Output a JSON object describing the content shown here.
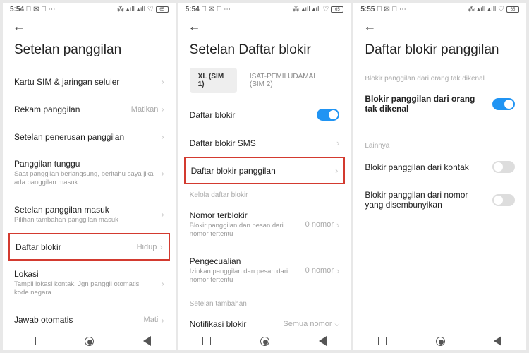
{
  "screen1": {
    "time": "5:54",
    "status_icons": "⃠ ✉ ⛶ ⋯",
    "status_right": "⁂ ▴ıll ▴ıll ♡",
    "battery": "65",
    "title": "Setelan panggilan",
    "rows": [
      {
        "label": "Kartu SIM & jaringan seluler",
        "value": "",
        "sub": ""
      },
      {
        "label": "Rekam panggilan",
        "value": "Matikan",
        "sub": ""
      },
      {
        "label": "Setelan penerusan panggilan",
        "value": "",
        "sub": ""
      },
      {
        "label": "Panggilan tunggu",
        "value": "",
        "sub": "Saat panggilan berlangsung, beritahu saya jika ada panggilan masuk"
      },
      {
        "label": "Setelan panggilan masuk",
        "value": "",
        "sub": "Pilihan tambahan panggilan masuk"
      },
      {
        "label": "Daftar blokir",
        "value": "Hidup",
        "sub": ""
      },
      {
        "label": "Lokasi",
        "value": "",
        "sub": "Tampil lokasi kontak, Jgn panggil otomatis kode negara"
      },
      {
        "label": "Jawab otomatis",
        "value": "Mati",
        "sub": ""
      }
    ]
  },
  "screen2": {
    "time": "5:54",
    "battery": "65",
    "title": "Setelan Daftar blokir",
    "tabs": [
      {
        "label": "XL (SIM 1)",
        "active": true
      },
      {
        "label": "ISAT-PEMILUDAMAI (SIM 2)",
        "active": false
      }
    ],
    "rows_top": [
      {
        "label": "Daftar blokir",
        "type": "toggle",
        "on": true
      },
      {
        "label": "Daftar blokir SMS",
        "type": "chev"
      },
      {
        "label": "Daftar blokir panggilan",
        "type": "chev",
        "highlight": true
      }
    ],
    "section1": "Kelola daftar blokir",
    "rows_mid": [
      {
        "label": "Nomor terblokir",
        "sub": "Blokir panggilan dan pesan dari nomor tertentu",
        "value": "0 nomor"
      },
      {
        "label": "Pengecualian",
        "sub": "Izinkan panggilan dan pesan dari nomor tertentu",
        "value": "0 nomor"
      }
    ],
    "section2": "Setelan tambahan",
    "rows_bot": [
      {
        "label": "Notifikasi blokir",
        "value": "Semua nomor"
      }
    ]
  },
  "screen3": {
    "time": "5:55",
    "battery": "65",
    "title": "Daftar blokir panggilan",
    "section_top": "Blokir panggilan dari orang tak dikenal",
    "rows_top": [
      {
        "label": "Blokir panggilan dari orang tak dikenal",
        "on": true
      }
    ],
    "section_bot": "Lainnya",
    "rows_bot": [
      {
        "label": "Blokir panggilan dari kontak",
        "on": false
      },
      {
        "label": "Blokir panggilan dari nomor yang disembunyikan",
        "on": false
      }
    ]
  }
}
